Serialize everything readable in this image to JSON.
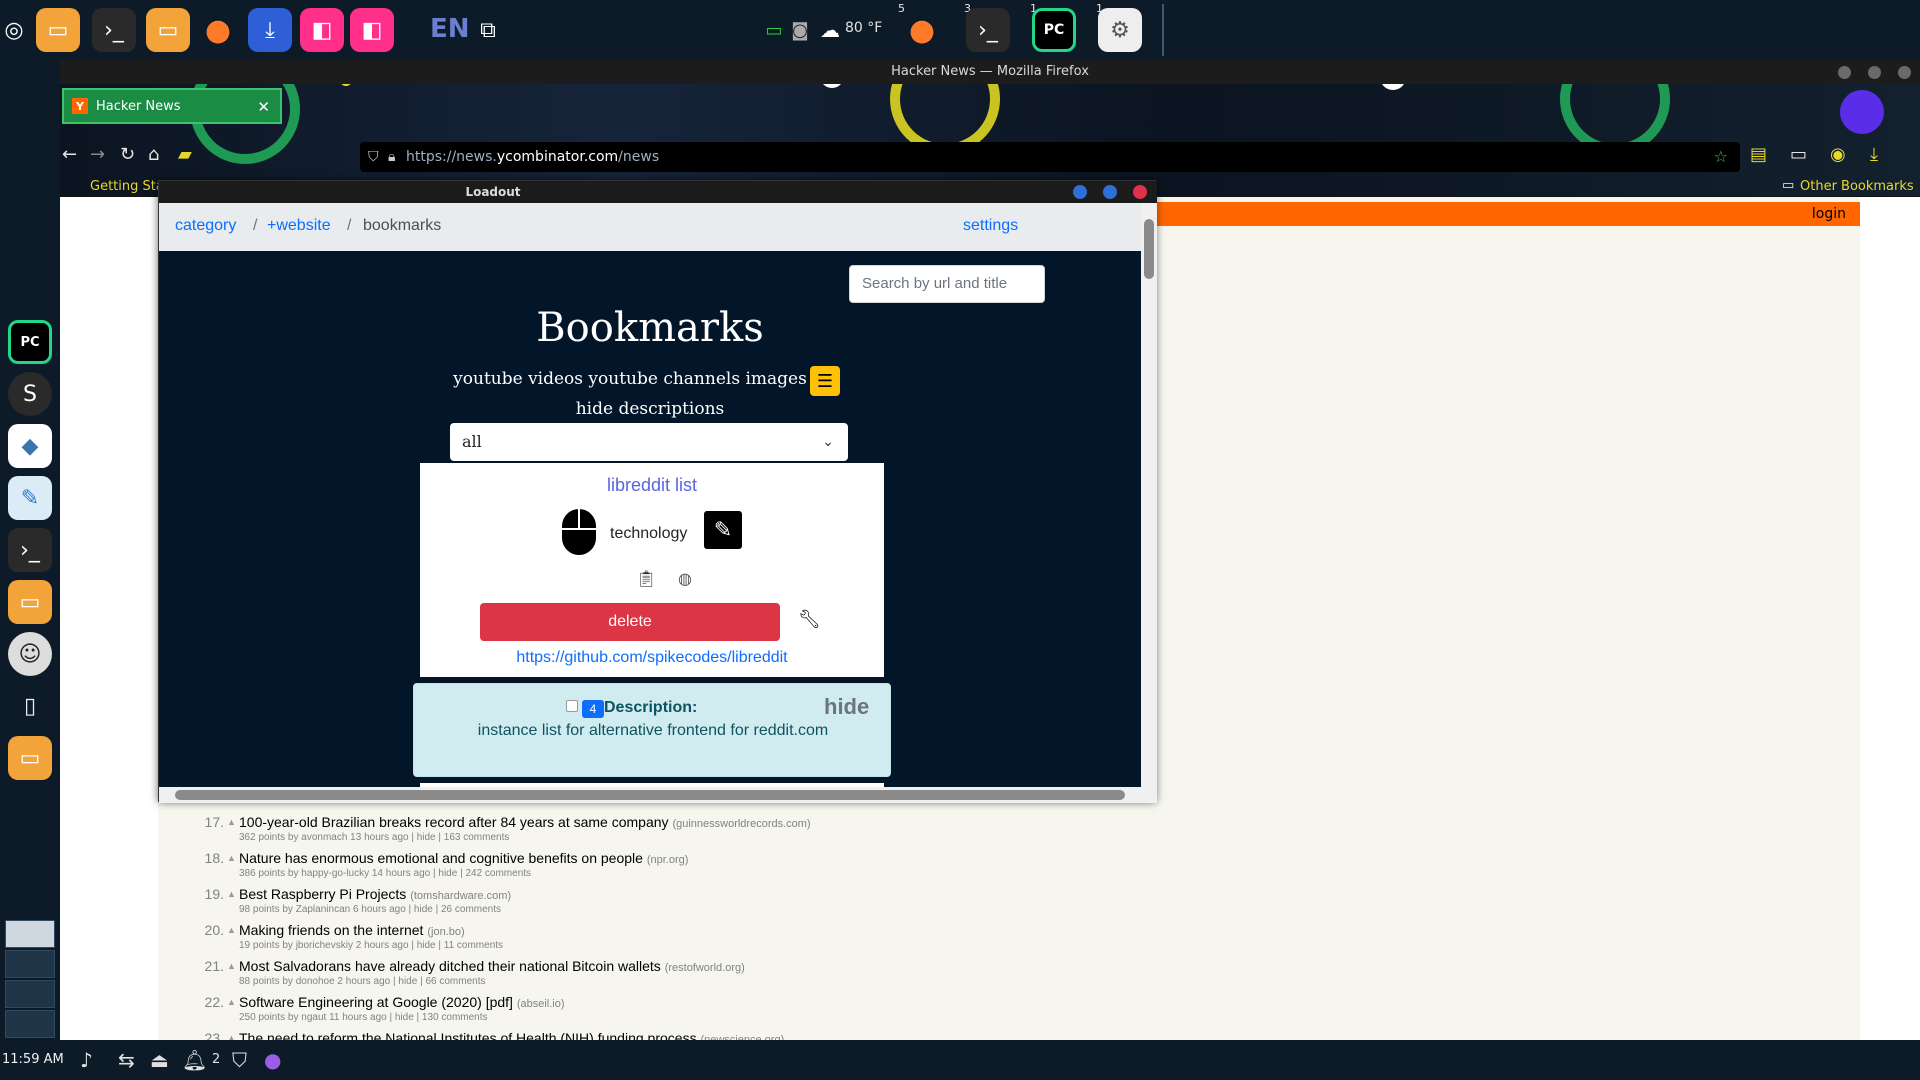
{
  "taskbar": {
    "language": "EN",
    "weather": "80 °F",
    "badges": [
      "5",
      "3",
      "1",
      "1"
    ],
    "icons": [
      "mint-menu-icon",
      "files-icon",
      "terminal-icon",
      "folder-icon",
      "firefox-icon",
      "download-icon",
      "shop-icon",
      "shop-icon-2",
      "workspace-icon"
    ]
  },
  "bottom": {
    "clock": "11:59 AM",
    "notification_count": "2"
  },
  "firefox": {
    "window_title": "Hacker News — Mozilla Firefox",
    "tab_title": "Hacker News",
    "url_prefix": "https://news.",
    "url_host": "ycombinator.com",
    "url_path": "/news",
    "bookmark_left": "Getting Sta",
    "bookmark_right": "Other Bookmarks"
  },
  "hn": {
    "login": "login",
    "stories": [
      {
        "rank": "17.",
        "title": "100-year-old Brazilian breaks record after 84 years at same company",
        "site": "(guinnessworldrecords.com)",
        "sub": "362 points by avonmach 13 hours ago | hide | 163 comments"
      },
      {
        "rank": "18.",
        "title": "Nature has enormous emotional and cognitive benefits on people",
        "site": "(npr.org)",
        "sub": "386 points by happy-go-lucky 14 hours ago | hide | 242 comments"
      },
      {
        "rank": "19.",
        "title": "Best Raspberry Pi Projects",
        "site": "(tomshardware.com)",
        "sub": "98 points by Zaplanincan 6 hours ago | hide | 26 comments"
      },
      {
        "rank": "20.",
        "title": "Making friends on the internet",
        "site": "(jon.bo)",
        "sub": "19 points by jborichevskiy 2 hours ago | hide | 11 comments"
      },
      {
        "rank": "21.",
        "title": "Most Salvadorans have already ditched their national Bitcoin wallets",
        "site": "(restofworld.org)",
        "sub": "88 points by donohoe 2 hours ago | hide | 66 comments"
      },
      {
        "rank": "22.",
        "title": "Software Engineering at Google (2020) [pdf]",
        "site": "(abseil.io)",
        "sub": "250 points by ngaut 11 hours ago | hide | 130 comments"
      },
      {
        "rank": "23.",
        "title": "The need to reform the National Institutes of Health (NIH) funding process",
        "site": "(newscience.org)",
        "sub": ""
      }
    ]
  },
  "loadout": {
    "window_title": "Loadout",
    "breadcrumbs": [
      "category",
      "+website",
      "bookmarks"
    ],
    "settings": "settings",
    "search_placeholder": "Search by url and title",
    "heading": "Bookmarks",
    "links_line": "youtube videos youtube channels images",
    "hide_descriptions": "hide descriptions",
    "filter_value": "all",
    "card": {
      "title": "libreddit list",
      "category": "technology",
      "delete_label": "delete",
      "url": "https://github.com/spikecodes/libreddit"
    },
    "description": {
      "badge": "4",
      "label": "Description:",
      "hide_label": "hide",
      "text": "instance list for alternative frontend for reddit.com"
    }
  }
}
